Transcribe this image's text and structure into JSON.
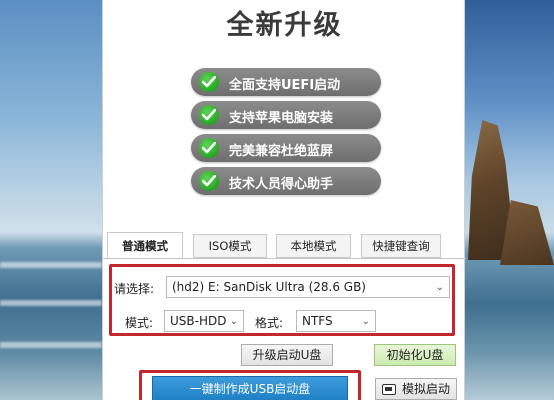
{
  "window": {
    "title": "全新升级"
  },
  "features": [
    {
      "text": "全面支持UEFI启动",
      "icon": "check-icon"
    },
    {
      "text": "支持苹果电脑安装",
      "icon": "check-icon"
    },
    {
      "text": "完美兼容杜绝蓝屏",
      "icon": "check-icon"
    },
    {
      "text": "技术人员得心助手",
      "icon": "check-icon"
    }
  ],
  "tabs": [
    {
      "label": "普通模式",
      "active": true
    },
    {
      "label": "ISO模式",
      "active": false
    },
    {
      "label": "本地模式",
      "active": false
    },
    {
      "label": "快捷键查询",
      "active": false
    }
  ],
  "form": {
    "device_label": "请选择:",
    "device_value": "(hd2) E: SanDisk Ultra (28.6 GB)",
    "mode_label": "模式:",
    "mode_value": "USB-HDD",
    "format_label": "格式:",
    "format_value": "NTFS"
  },
  "buttons": {
    "upgrade": "升级启动U盘",
    "init": "初始化U盘",
    "make": "一键制作成USB启动盘",
    "simulate": "模拟启动"
  },
  "colors": {
    "highlight": "#c4262e",
    "feature_pill": "#7a7a7a",
    "check": "#25a91f",
    "primary_button": "#1e7fc4"
  }
}
